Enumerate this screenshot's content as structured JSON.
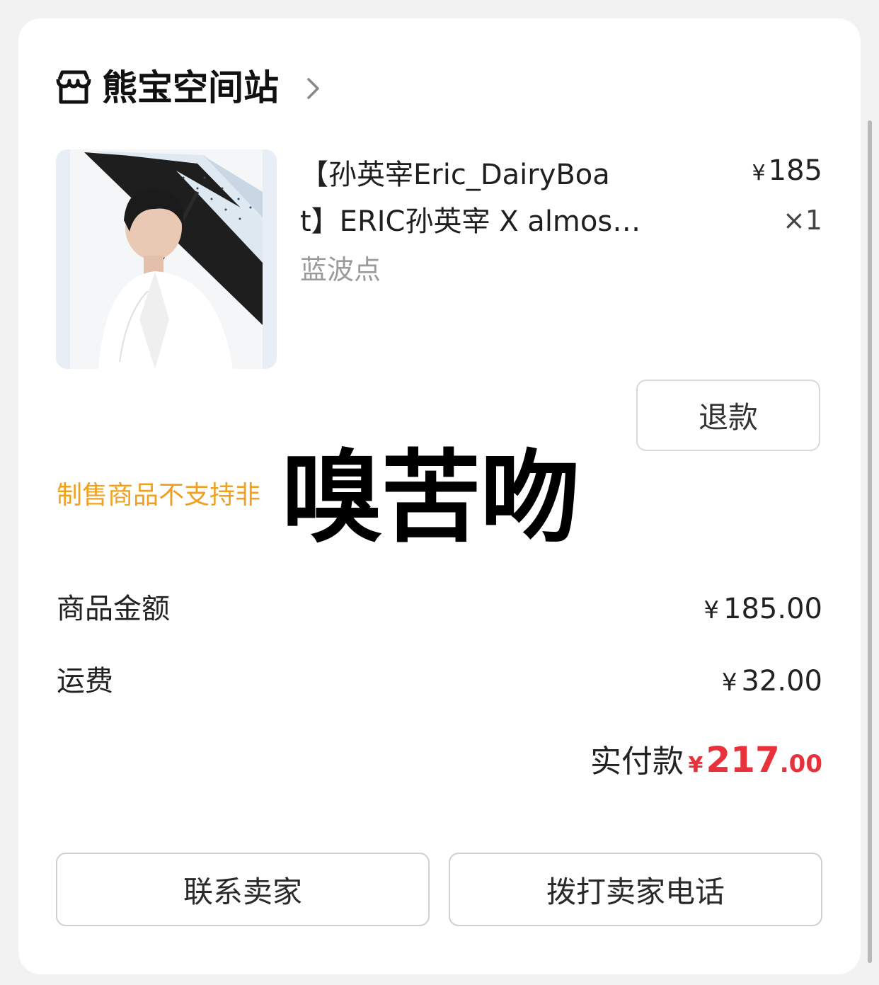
{
  "shop": {
    "name": "熊宝空间站"
  },
  "product": {
    "title_line1": "【孙英宰Eric_DairyBoa",
    "title_line2": "t】ERIC孙英宰 X almos…",
    "variant": "蓝波点",
    "price_symbol": "¥",
    "price": "185",
    "quantity": "×1"
  },
  "refund_label": "退款",
  "notice": "制售商品不支持非",
  "sticker_text": "嗅苦吻",
  "summary": {
    "goods_label": "商品金额",
    "goods_value": "185.00",
    "shipping_label": "运费",
    "shipping_value": "32.00",
    "currency": "¥",
    "paid_label": "实付款",
    "paid_int": "217",
    "paid_dec": ".00"
  },
  "actions": {
    "contact_seller": "联系卖家",
    "call_seller": "拨打卖家电话"
  },
  "colors": {
    "accent_red": "#e8313a",
    "notice_orange": "#f0a020"
  }
}
